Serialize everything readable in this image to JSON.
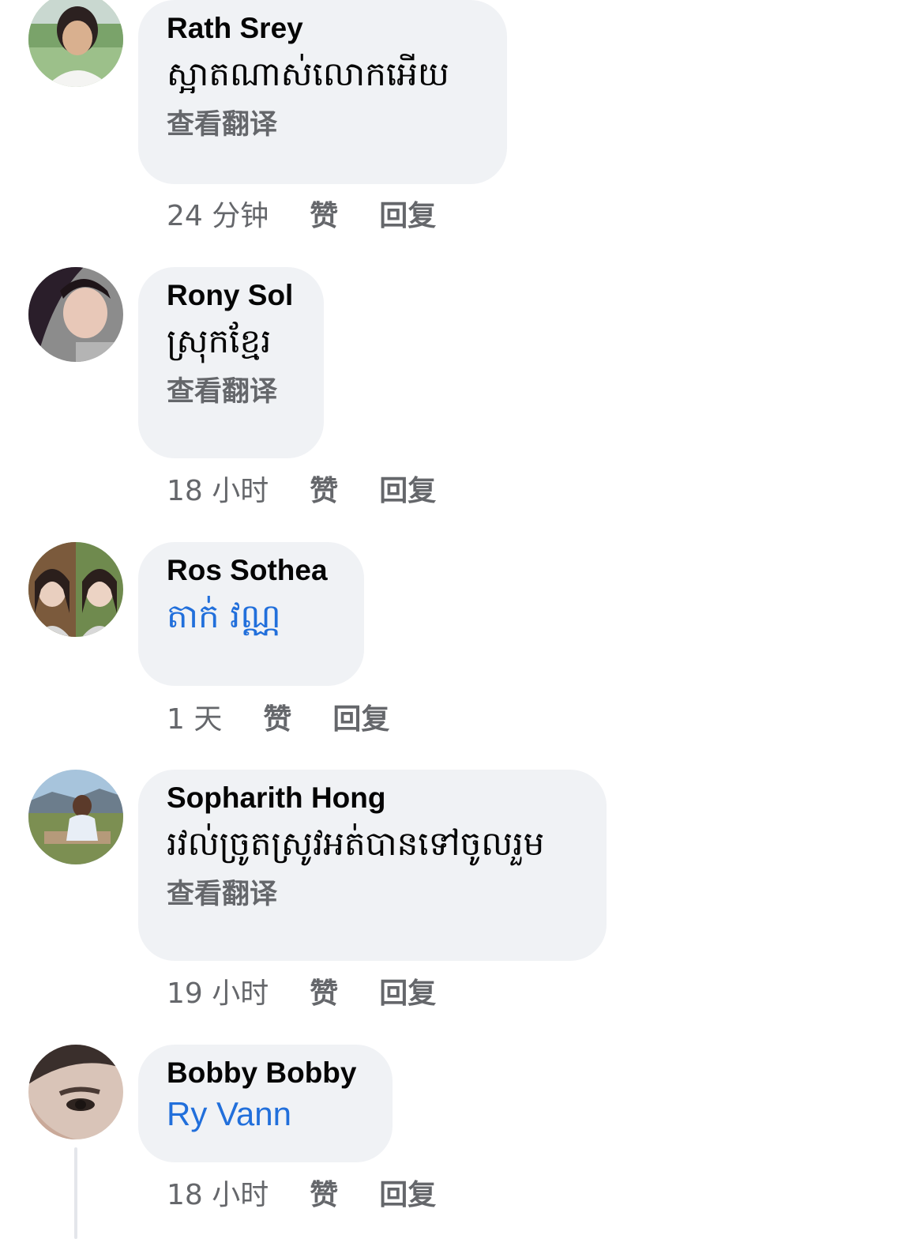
{
  "comments": [
    {
      "author": "Rath Srey",
      "text": "ស្អាតណាស់លោកអើយ",
      "translate": "查看翻译",
      "time": "24 分钟",
      "like": "赞",
      "reply": "回复"
    },
    {
      "author": "Rony Sol",
      "text": "ស្រុកខ្មែរ",
      "translate": "查看翻译",
      "time": "18 小时",
      "like": "赞",
      "reply": "回复"
    },
    {
      "author": "Ros Sothea",
      "text": "តាក់ វណ្ណ",
      "time": "1 天",
      "like": "赞",
      "reply": "回复"
    },
    {
      "author": "Sopharith Hong",
      "text": "រវល់ច្រូតស្រូវអត់បានទៅចូលរួម",
      "translate": "查看翻译",
      "time": "19 小时",
      "like": "赞",
      "reply": "回复"
    },
    {
      "author": "Bobby Bobby",
      "text": "Ry Vann",
      "time": "18 小时",
      "like": "赞",
      "reply": "回复"
    }
  ],
  "colors": {
    "bubble_bg": "#f0f2f5",
    "author_text": "#050505",
    "secondary_text": "#65676b",
    "mention_link": "#216fdb",
    "thread_line": "#e4e6eb"
  }
}
